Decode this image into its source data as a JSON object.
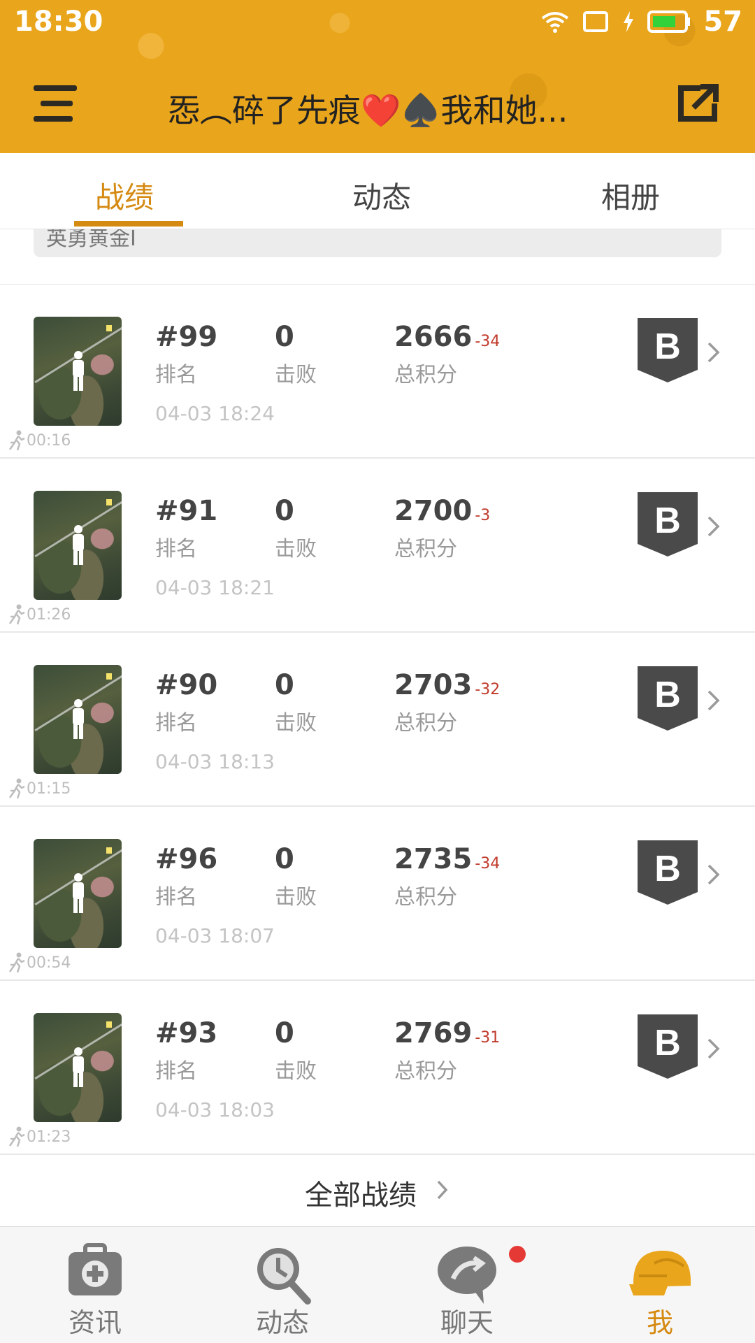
{
  "status_bar": {
    "time": "18:30",
    "battery": "57"
  },
  "header": {
    "title": "㤅︵碎了先痕❤️♠️我和她..."
  },
  "tabs": [
    {
      "label": "战绩",
      "active": true
    },
    {
      "label": "动态",
      "active": false
    },
    {
      "label": "相册",
      "active": false
    }
  ],
  "top_banner": {
    "text": "英勇黄金I"
  },
  "match_labels": {
    "rank": "排名",
    "kills": "击败",
    "score": "总积分"
  },
  "badge_letter": "B",
  "matches": [
    {
      "rank": "#99",
      "kills": "0",
      "score": "2666",
      "delta": "-34",
      "time": "04-03 18:24",
      "duration": "00:16"
    },
    {
      "rank": "#91",
      "kills": "0",
      "score": "2700",
      "delta": "-3",
      "time": "04-03 18:21",
      "duration": "01:26"
    },
    {
      "rank": "#90",
      "kills": "0",
      "score": "2703",
      "delta": "-32",
      "time": "04-03 18:13",
      "duration": "01:15"
    },
    {
      "rank": "#96",
      "kills": "0",
      "score": "2735",
      "delta": "-34",
      "time": "04-03 18:07",
      "duration": "00:54"
    },
    {
      "rank": "#93",
      "kills": "0",
      "score": "2769",
      "delta": "-31",
      "time": "04-03 18:03",
      "duration": "01:23"
    }
  ],
  "all_records": {
    "label": "全部战绩"
  },
  "bottom_nav": [
    {
      "label": "资讯",
      "icon": "medkit-icon",
      "active": false
    },
    {
      "label": "动态",
      "icon": "pan-clock-icon",
      "active": false
    },
    {
      "label": "聊天",
      "icon": "chat-icon",
      "active": false,
      "badge": true
    },
    {
      "label": "我",
      "icon": "helmet-icon",
      "active": true
    }
  ],
  "colors": {
    "header": "#e9a51b",
    "accent": "#d58a12",
    "delta": "#c0392b",
    "badge_dot": "#e53935"
  }
}
